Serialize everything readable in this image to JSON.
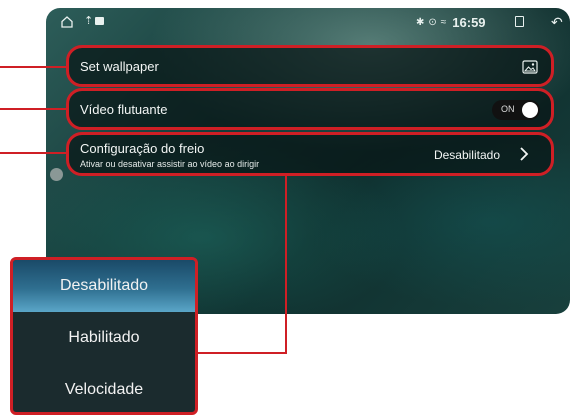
{
  "status_bar": {
    "clock": "16:59",
    "icons": [
      "home-icon",
      "usb-icon",
      "image-icon",
      "bluetooth-icon",
      "location-icon",
      "wifi-icon",
      "recent-apps-icon",
      "back-icon"
    ]
  },
  "settings": {
    "wallpaper": {
      "label": "Set wallpaper",
      "icon": "wallpaper-icon"
    },
    "floating_video": {
      "label": "Vídeo flutuante",
      "toggle_text": "ON",
      "enabled": true
    },
    "brake_config": {
      "title": "Configuração do freio",
      "subtitle": "Ativar ou desativar assistir ao vídeo ao dirigir",
      "value": "Desabilitado"
    }
  },
  "dropdown": {
    "options": [
      "Desabilitado",
      "Habilitado",
      "Velocidade"
    ],
    "selected": "Desabilitado"
  },
  "colors": {
    "highlight": "#cf1f25",
    "selected_option": "#2f6f90"
  }
}
